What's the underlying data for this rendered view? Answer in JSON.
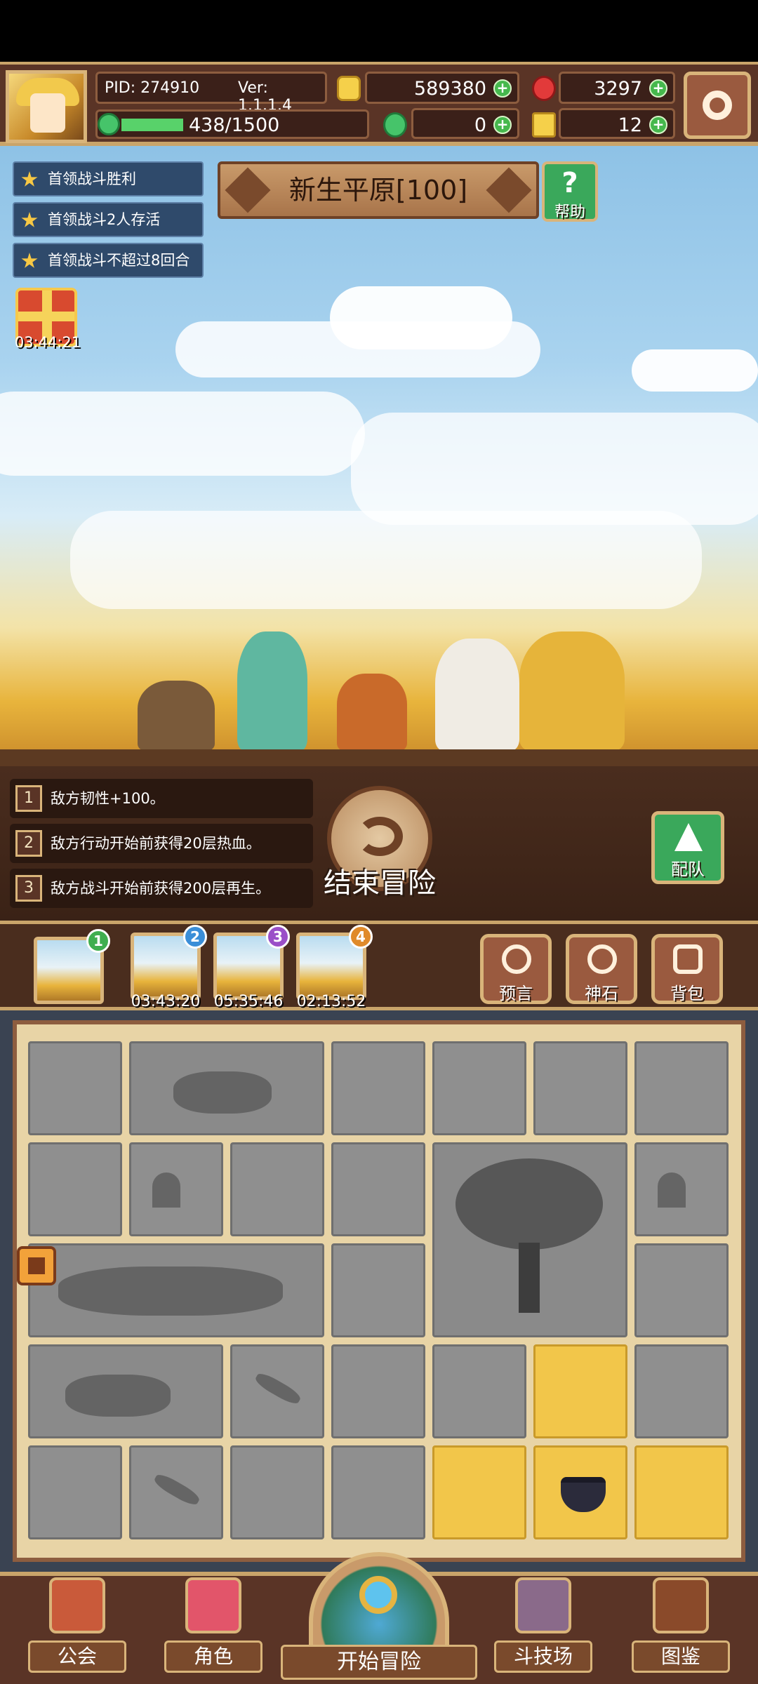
{
  "topbar": {
    "pid": "PID: 274910",
    "version": "Ver: 1.1.1.4",
    "gold": "589380",
    "gems": "3297",
    "exp": "438/1500",
    "exp_progress": 0.292,
    "clover": "0",
    "keys": "12"
  },
  "quests": [
    "首领战斗胜利",
    "首领战斗2人存活",
    "首领战斗不超过8回合"
  ],
  "gift_timer": "03:44:21",
  "stage": {
    "title": "新生平原[100]",
    "help_label": "帮助"
  },
  "effects": [
    {
      "num": "1",
      "text": "敌方韧性+100。"
    },
    {
      "num": "2",
      "text": "敌方行动开始前获得20层热血。"
    },
    {
      "num": "3",
      "text": "敌方战斗开始前获得200层再生。"
    }
  ],
  "end_adventure_label": "结束冒险",
  "team_label": "配队",
  "slots": [
    {
      "badge": "1",
      "time": "",
      "badge_color": "#3fae4f"
    },
    {
      "badge": "2",
      "time": "03:43:20",
      "badge_color": "#3a8ed8"
    },
    {
      "badge": "3",
      "time": "05:35:46",
      "badge_color": "#9a4fc8"
    },
    {
      "badge": "4",
      "time": "02:13:52",
      "badge_color": "#e08a2a"
    }
  ],
  "functions": {
    "prophecy": "预言",
    "godstone": "神石",
    "backpack": "背包"
  },
  "nav": {
    "guild": "公会",
    "character": "角色",
    "start": "开始冒险",
    "arena": "斗技场",
    "codex": "图鉴"
  }
}
